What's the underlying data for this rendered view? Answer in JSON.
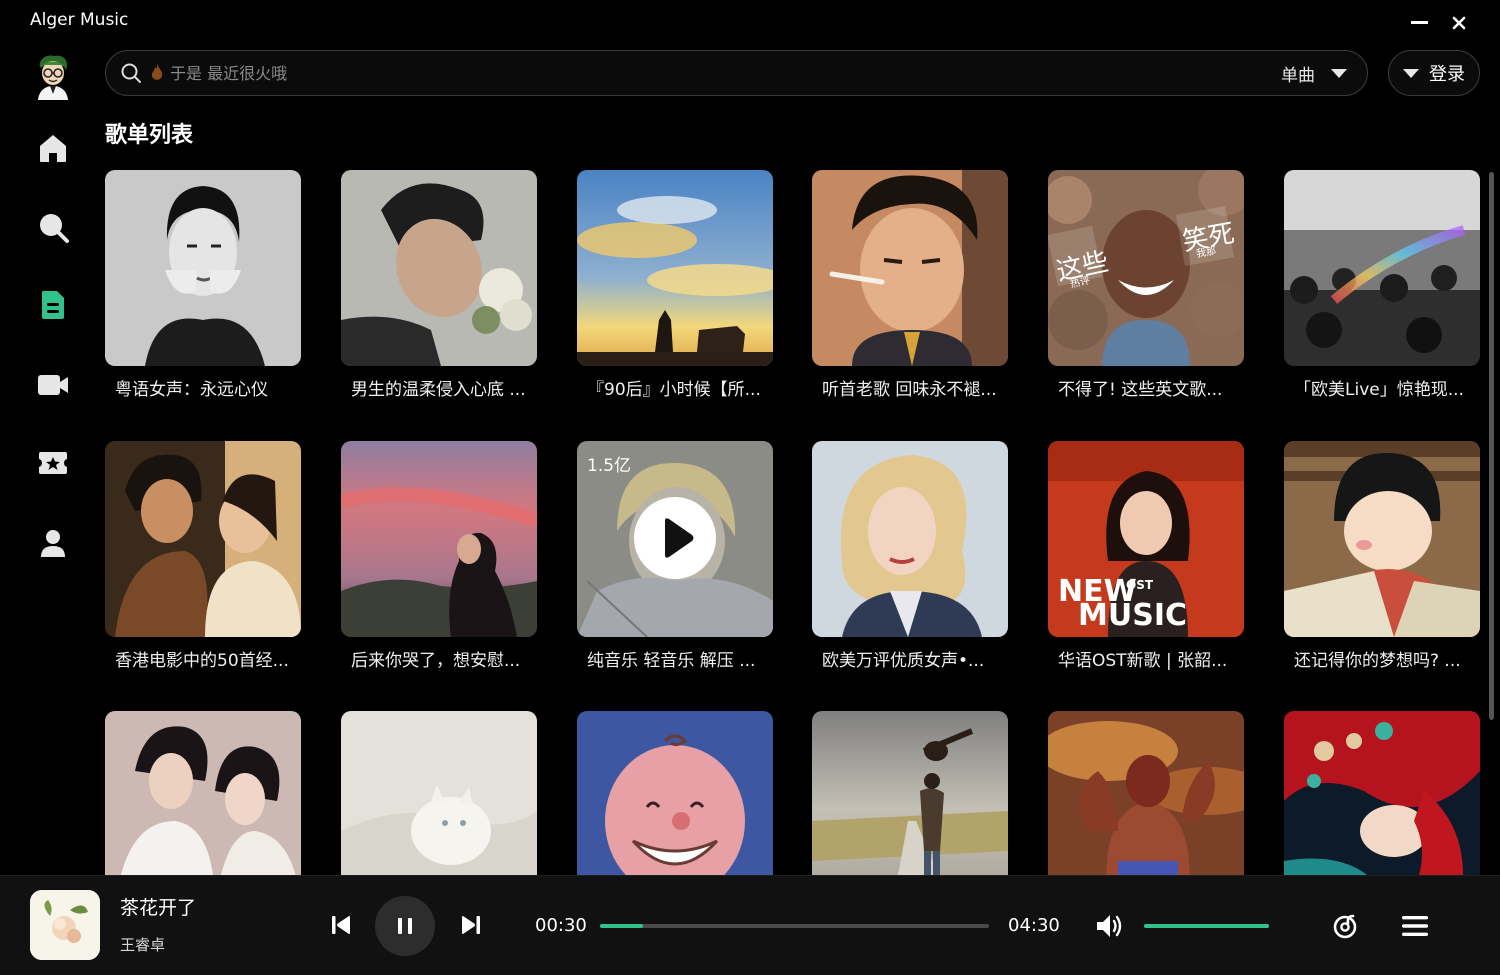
{
  "app": {
    "title": "Alger Music"
  },
  "search": {
    "placeholder": "于是 最近很火哦",
    "type_label": "单曲"
  },
  "login": {
    "label": "登录"
  },
  "section": {
    "title": "歌单列表"
  },
  "nav": [
    {
      "icon": "home-icon",
      "active": false
    },
    {
      "icon": "search-icon",
      "active": false
    },
    {
      "icon": "playlist-icon",
      "active": true
    },
    {
      "icon": "video-icon",
      "active": false
    },
    {
      "icon": "ranking-icon",
      "active": false
    },
    {
      "icon": "user-icon",
      "active": false
    }
  ],
  "playlists": [
    {
      "title": "粤语女声：永远心仪"
    },
    {
      "title": "男生的温柔侵入心底 ..."
    },
    {
      "title": "『90后』小时候【所..."
    },
    {
      "title": "听首老歌 回味永不褪..."
    },
    {
      "title": "不得了! 这些英文歌..."
    },
    {
      "title": "「欧美Live」惊艳现..."
    },
    {
      "title": "香港电影中的50首经..."
    },
    {
      "title": "后来你哭了，想安慰..."
    },
    {
      "title": "纯音乐 轻音乐 解压 ...",
      "play_count": "1.5亿"
    },
    {
      "title": "欧美万评优质女声•..."
    },
    {
      "title": "华语OST新歌 | 张韶..."
    },
    {
      "title": "还记得你的梦想吗? ..."
    },
    {
      "title": ""
    },
    {
      "title": ""
    },
    {
      "title": ""
    },
    {
      "title": ""
    },
    {
      "title": ""
    },
    {
      "title": ""
    }
  ],
  "cover_texts": {
    "drake_left": "这些",
    "drake_right": "笑死",
    "drake_tag1": "热评",
    "drake_tag2": "我那",
    "ost_new": "NEW",
    "ost_sup": "OST",
    "ost_music": "MUSIC"
  },
  "player": {
    "title": "茶花开了",
    "artist": "王睿卓",
    "current_time": "00:30",
    "total_time": "04:30",
    "progress": 0.11,
    "volume": 1.0,
    "accent": "#33c18b"
  }
}
